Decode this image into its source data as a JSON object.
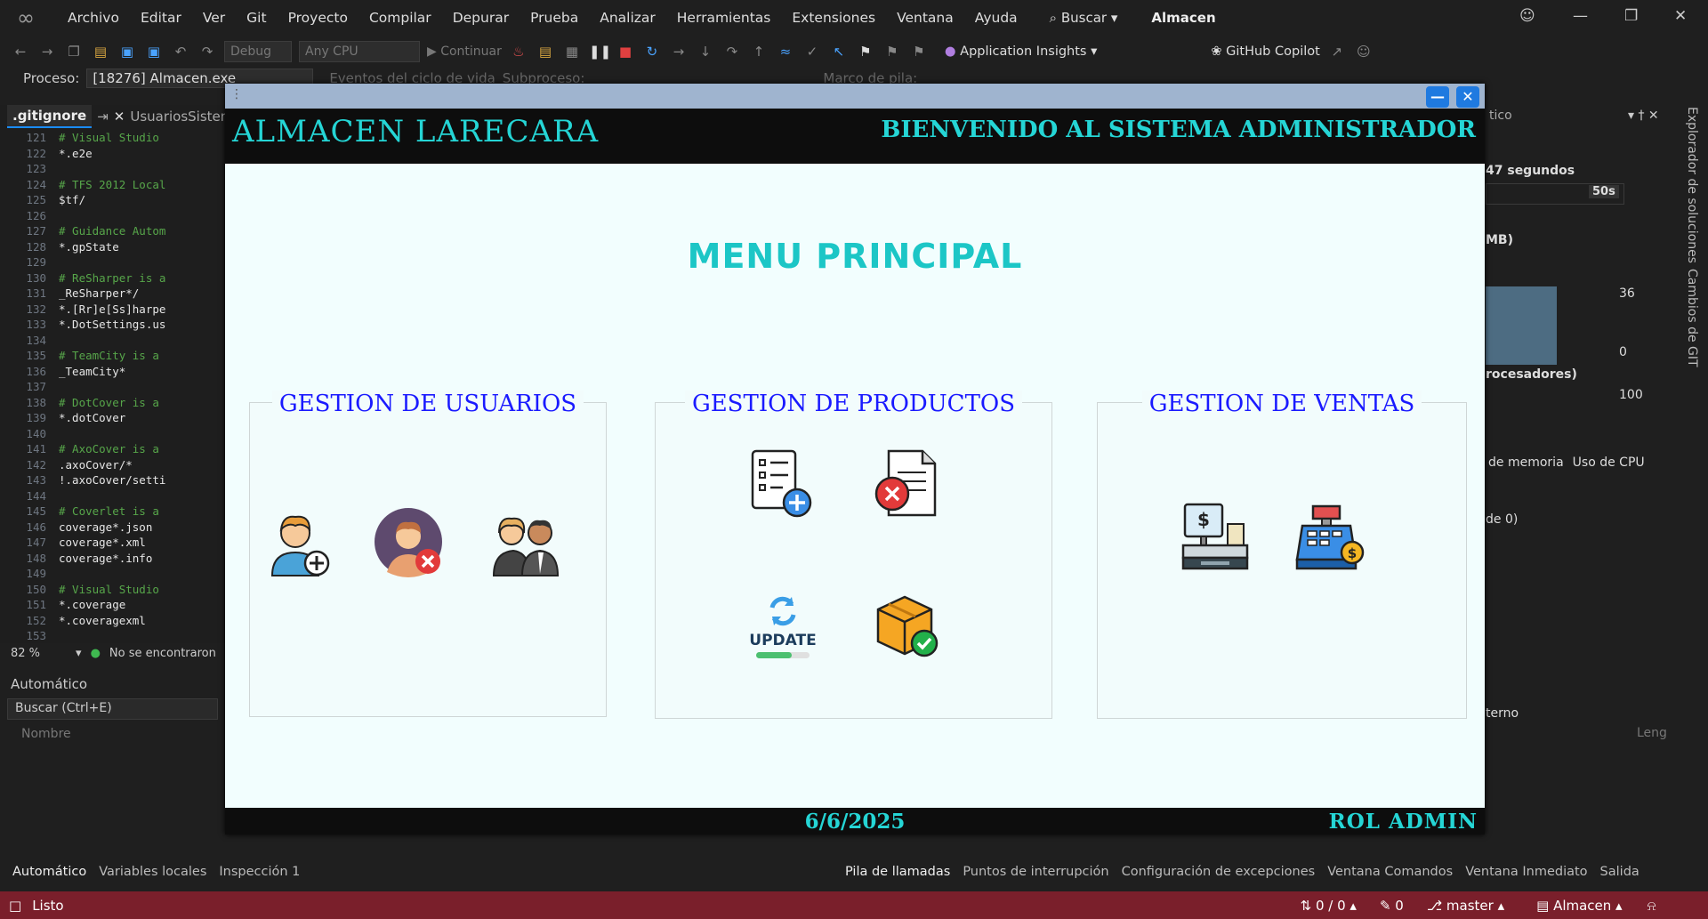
{
  "menubar": {
    "items": [
      "Archivo",
      "Editar",
      "Ver",
      "Git",
      "Proyecto",
      "Compilar",
      "Depurar",
      "Prueba",
      "Analizar",
      "Herramientas",
      "Extensiones",
      "Ventana",
      "Ayuda"
    ],
    "search": "Buscar",
    "app_title": "Almacen"
  },
  "toolbar": {
    "config": "Debug",
    "platform": "Any CPU",
    "continue": "Continuar",
    "insights": "Application Insights",
    "copilot": "GitHub Copilot"
  },
  "procbar": {
    "label": "Proceso:",
    "value": "[18276] Almacen.exe",
    "events": "Eventos del ciclo de vida",
    "thread": "Subproceso:",
    "stack": "Marco de pila:"
  },
  "editor": {
    "tabs": [
      ".gitignore",
      "UsuariosSistema"
    ],
    "lines": [
      {
        "n": "121",
        "t": "# Visual Studio",
        "c": true
      },
      {
        "n": "122",
        "t": "*.e2e",
        "c": false
      },
      {
        "n": "123",
        "t": "",
        "c": false
      },
      {
        "n": "124",
        "t": "# TFS 2012 Local",
        "c": true
      },
      {
        "n": "125",
        "t": "$tf/",
        "c": false
      },
      {
        "n": "126",
        "t": "",
        "c": false
      },
      {
        "n": "127",
        "t": "# Guidance Autom",
        "c": true
      },
      {
        "n": "128",
        "t": "*.gpState",
        "c": false
      },
      {
        "n": "129",
        "t": "",
        "c": false
      },
      {
        "n": "130",
        "t": "# ReSharper is a",
        "c": true
      },
      {
        "n": "131",
        "t": "_ReSharper*/",
        "c": false
      },
      {
        "n": "132",
        "t": "*.[Rr]e[Ss]harpe",
        "c": false
      },
      {
        "n": "133",
        "t": "*.DotSettings.us",
        "c": false
      },
      {
        "n": "134",
        "t": "",
        "c": false
      },
      {
        "n": "135",
        "t": "# TeamCity is a",
        "c": true
      },
      {
        "n": "136",
        "t": "_TeamCity*",
        "c": false
      },
      {
        "n": "137",
        "t": "",
        "c": false
      },
      {
        "n": "138",
        "t": "# DotCover is a",
        "c": true
      },
      {
        "n": "139",
        "t": "*.dotCover",
        "c": false
      },
      {
        "n": "140",
        "t": "",
        "c": false
      },
      {
        "n": "141",
        "t": "# AxoCover is a",
        "c": true
      },
      {
        "n": "142",
        "t": ".axoCover/*",
        "c": false
      },
      {
        "n": "143",
        "t": "!.axoCover/setti",
        "c": false
      },
      {
        "n": "144",
        "t": "",
        "c": false
      },
      {
        "n": "145",
        "t": "# Coverlet is a",
        "c": true
      },
      {
        "n": "146",
        "t": "coverage*.json",
        "c": false
      },
      {
        "n": "147",
        "t": "coverage*.xml",
        "c": false
      },
      {
        "n": "148",
        "t": "coverage*.info",
        "c": false
      },
      {
        "n": "149",
        "t": "",
        "c": false
      },
      {
        "n": "150",
        "t": "# Visual Studio",
        "c": true
      },
      {
        "n": "151",
        "t": "*.coverage",
        "c": false
      },
      {
        "n": "152",
        "t": "*.coveragexml",
        "c": false
      },
      {
        "n": "153",
        "t": "",
        "c": false
      }
    ],
    "zoom": "82 %",
    "issues": "No se encontraron"
  },
  "auto_panel": {
    "title": "Automático",
    "search": "Buscar (Ctrl+E)",
    "column": "Nombre"
  },
  "bottom_tabs_left": [
    "Automático",
    "Variables locales",
    "Inspección 1"
  ],
  "bottom_tabs_right": [
    "Pila de llamadas",
    "Puntos de interrupción",
    "Configuración de excepciones",
    "Ventana Comandos",
    "Ventana Inmediato",
    "Salida"
  ],
  "diag": {
    "title": "tico",
    "seconds": "47 segundos",
    "timeline": "50s",
    "mem": "MB)",
    "v36": "36",
    "v0": "0",
    "cpu": "rocesadores)",
    "v100": "100",
    "tab_mem": "o de memoria",
    "tab_cpu": "Uso de CPU",
    "de0": "de 0)",
    "externo": "terno",
    "leng": "Leng"
  },
  "side_tabs": [
    "Explorador de soluciones",
    "Cambios de GIT"
  ],
  "status": {
    "ready": "Listo",
    "sync": "0 / 0",
    "edits": "0",
    "branch": "master",
    "repo": "Almacen"
  },
  "app": {
    "brand": "ALMACEN LARECARA",
    "welcome": "BIENVENIDO AL SISTEMA  ADMINISTRADOR",
    "menu_title": "MENU PRINCIPAL",
    "groups": {
      "users": "GESTION DE USUARIOS",
      "products": "GESTION DE PRODUCTOS",
      "sales": "GESTION DE VENTAS"
    },
    "update_text": "UPDATE",
    "date": "6/6/2025",
    "role": "ROL  ADMIN"
  },
  "colors": {
    "accent_cyan": "#25d5d5",
    "group_title": "#1a1aff",
    "status_bar": "#7a1f2b"
  }
}
